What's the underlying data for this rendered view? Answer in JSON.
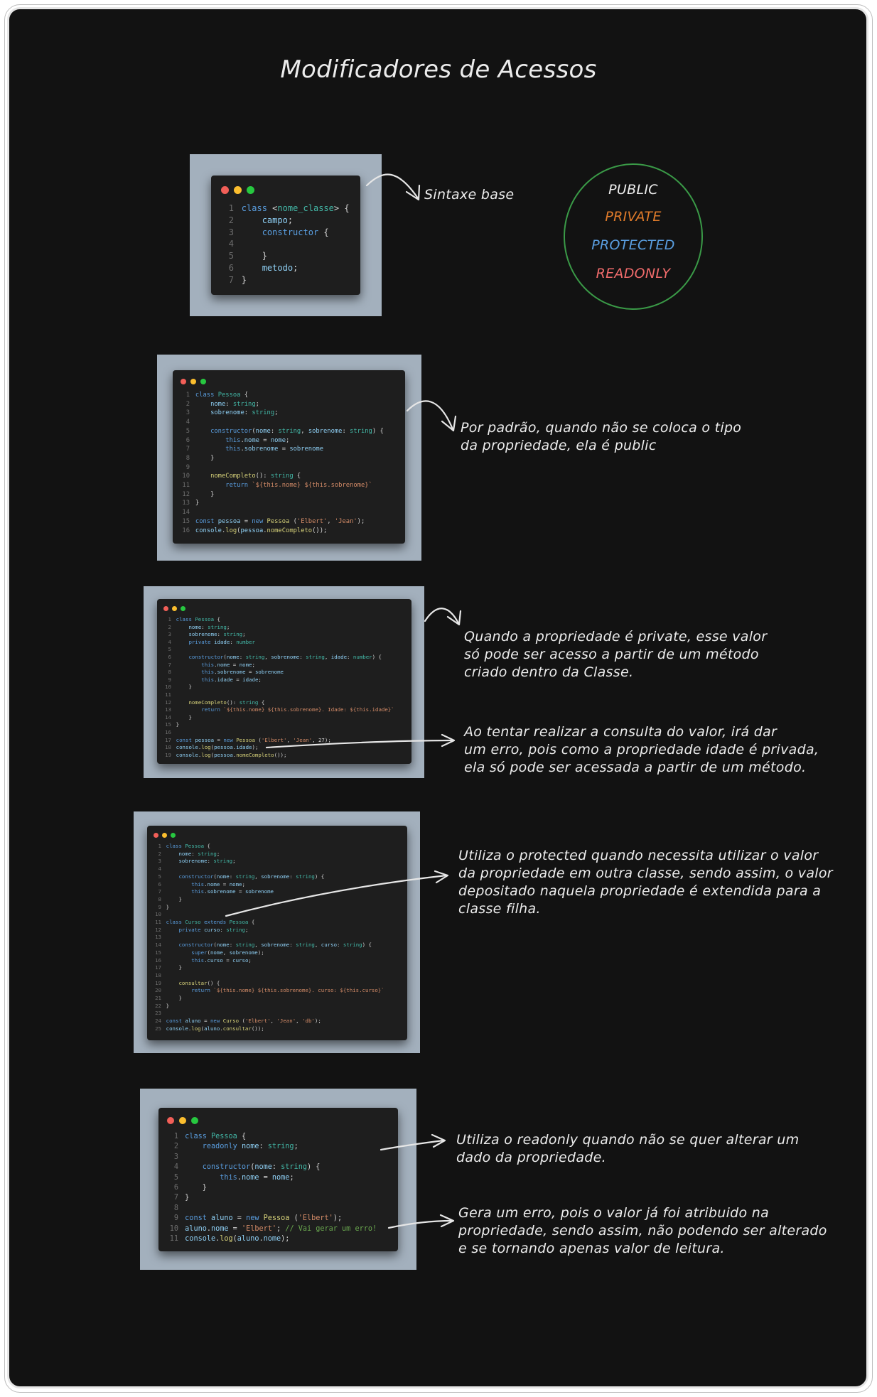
{
  "title": "Modificadores de Acessos",
  "modifiers": [
    {
      "label": "PUBLIC",
      "color": "#ececec"
    },
    {
      "label": "PRIVATE",
      "color": "#e07b2a"
    },
    {
      "label": "PROTECTED",
      "color": "#5a9ee0"
    },
    {
      "label": "READONLY",
      "color": "#f06b6b"
    }
  ],
  "circle_color": "#3a9a47",
  "frame_color": "#a3b0bd",
  "editor_dots": [
    "#f25f58",
    "#fbbe2e",
    "#27c840"
  ],
  "notes": {
    "syntax": "Sintaxe base",
    "public": "Por padrão, quando não se coloca o tipo\nda propriedade, ela é public",
    "private": "Quando a propriedade é private, esse valor\nsó pode ser acesso a partir de um método\ncriado dentro da Classe.",
    "private_error": "Ao tentar realizar a consulta do valor, irá dar\num erro, pois como a propriedade idade é privada,\nela só pode ser acessada a partir de um método.",
    "protected": "Utiliza o protected quando necessita utilizar o valor\nda propriedade em outra classe, sendo assim, o valor\ndepositado naquela propriedade é extendida para a\nclasse filha.",
    "readonly": "Utiliza o readonly quando não se quer alterar um\ndado da propriedade.",
    "readonly_error": "Gera um erro, pois o valor já foi atribuido na\npropriedade, sendo assim, não podendo ser alterado\ne se tornando apenas valor de leitura."
  },
  "snippets": {
    "syntax": [
      "class <nome_classe> {",
      "    campo;",
      "    constructor {",
      "",
      "    }",
      "    metodo;",
      "}"
    ],
    "public": [
      "class Pessoa {",
      "    nome: string;",
      "    sobrenome: string;",
      "",
      "    constructor(nome: string, sobrenome: string) {",
      "        this.nome = nome;",
      "        this.sobrenome = sobrenome",
      "    }",
      "",
      "    nomeCompleto(): string {",
      "        return `${this.nome} ${this.sobrenome}`",
      "    }",
      "}",
      "",
      "const pessoa = new Pessoa ('Elbert', 'Jean');",
      "console.log(pessoa.nomeCompleto());"
    ],
    "private": [
      "class Pessoa {",
      "    nome: string;",
      "    sobrenome: string;",
      "    private idade: number",
      "",
      "    constructor(nome: string, sobrenome: string, idade: number) {",
      "        this.nome = nome;",
      "        this.sobrenome = sobrenome",
      "        this.idade = idade;",
      "    }",
      "",
      "    nomeCompleto(): string {",
      "        return `${this.nome} ${this.sobrenome}. Idade: ${this.idade}`",
      "    }",
      "}",
      "",
      "const pessoa = new Pessoa ('Elbert', 'Jean', 27);",
      "console.log(pessoa.idade);",
      "console.log(pessoa.nomeCompleto());"
    ],
    "protected": [
      "class Pessoa {",
      "    nome: string;",
      "    sobrenome: string;",
      "",
      "    constructor(nome: string, sobrenome: string) {",
      "        this.nome = nome;",
      "        this.sobrenome = sobrenome",
      "    }",
      "}",
      "",
      "class Curso extends Pessoa {",
      "    private curso: string;",
      "",
      "    constructor(nome: string, sobrenome: string, curso: string) {",
      "        super(nome, sobrenome);",
      "        this.curso = curso;",
      "    }",
      "",
      "    consultar() {",
      "        return `${this.nome} ${this.sobrenome}. curso: ${this.curso}`",
      "    }",
      "}",
      "",
      "const aluno = new Curso ('Elbert', 'Jean', 'db');",
      "console.log(aluno.consultar());"
    ],
    "readonly": [
      "class Pessoa {",
      "    readonly nome: string;",
      "",
      "    constructor(nome: string) {",
      "        this.nome = nome;",
      "    }",
      "}",
      "",
      "const aluno = new Pessoa ('Elbert');",
      "aluno.nome = 'Elbert'; // Vai gerar um erro!",
      "console.log(aluno.nome);"
    ]
  }
}
